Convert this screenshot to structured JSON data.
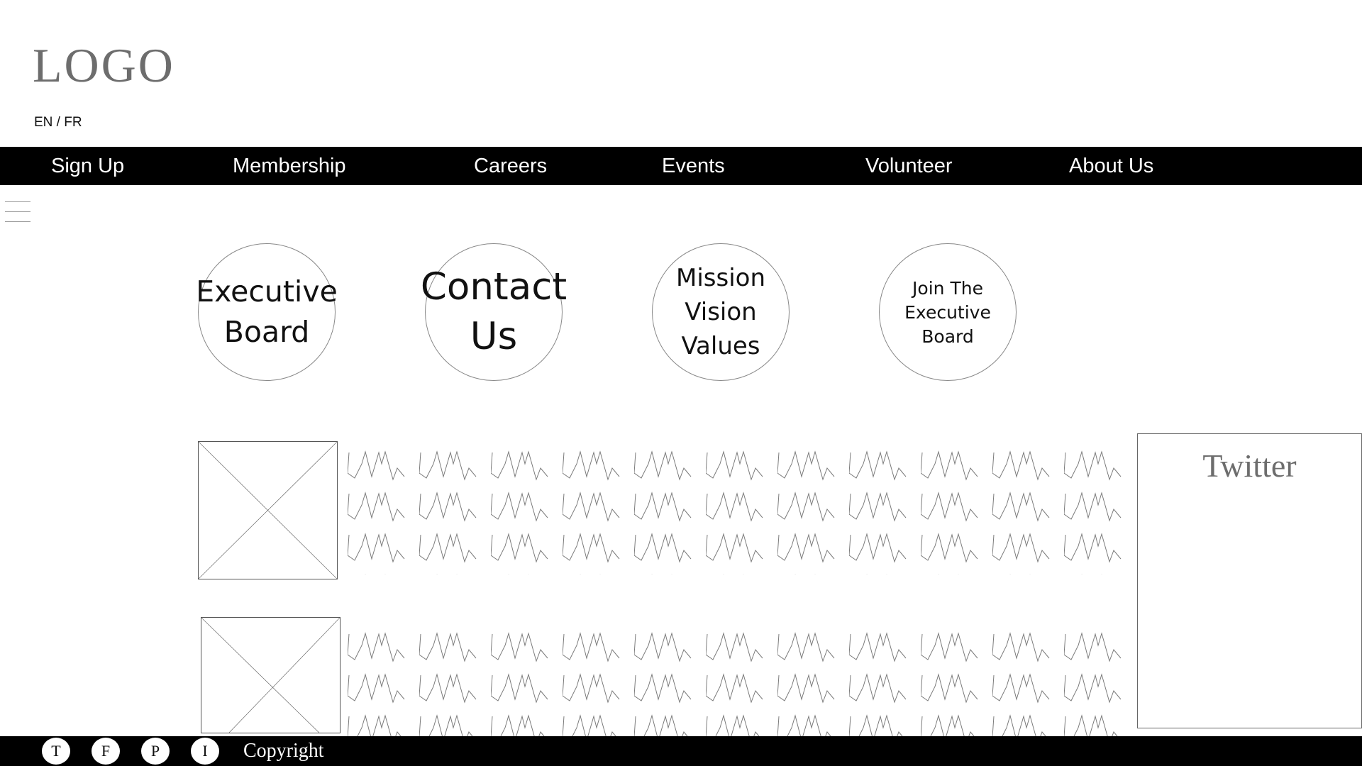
{
  "header": {
    "logo_text": "LOGO",
    "language_switch": "EN / FR"
  },
  "nav": {
    "items": [
      {
        "label": "Sign Up"
      },
      {
        "label": "Membership"
      },
      {
        "label": "Careers"
      },
      {
        "label": "Events"
      },
      {
        "label": "Volunteer"
      },
      {
        "label": "About Us"
      }
    ]
  },
  "menu_icon": "hamburger-icon",
  "quick_links": [
    {
      "lines": [
        "Executive",
        "Board"
      ]
    },
    {
      "lines": [
        "Contact",
        "Us"
      ]
    },
    {
      "lines": [
        "Mission",
        "Vision",
        "Values"
      ]
    },
    {
      "lines": [
        "Join The",
        "Executive Board"
      ]
    }
  ],
  "articles": [
    {
      "image": "image-placeholder-icon",
      "text": "placeholder-text-squiggle"
    },
    {
      "image": "image-placeholder-icon",
      "text": "placeholder-text-squiggle"
    }
  ],
  "twitter": {
    "title": "Twitter"
  },
  "footer": {
    "social": [
      {
        "letter": "T",
        "icon": "twitter-icon"
      },
      {
        "letter": "F",
        "icon": "facebook-icon"
      },
      {
        "letter": "P",
        "icon": "pinterest-icon"
      },
      {
        "letter": "I",
        "icon": "instagram-icon"
      }
    ],
    "copyright": "Copyright"
  },
  "colors": {
    "nav_background": "#000000",
    "nav_text": "#ffffff",
    "logo": "#6d6d6d",
    "wireframe_stroke": "#888888"
  }
}
